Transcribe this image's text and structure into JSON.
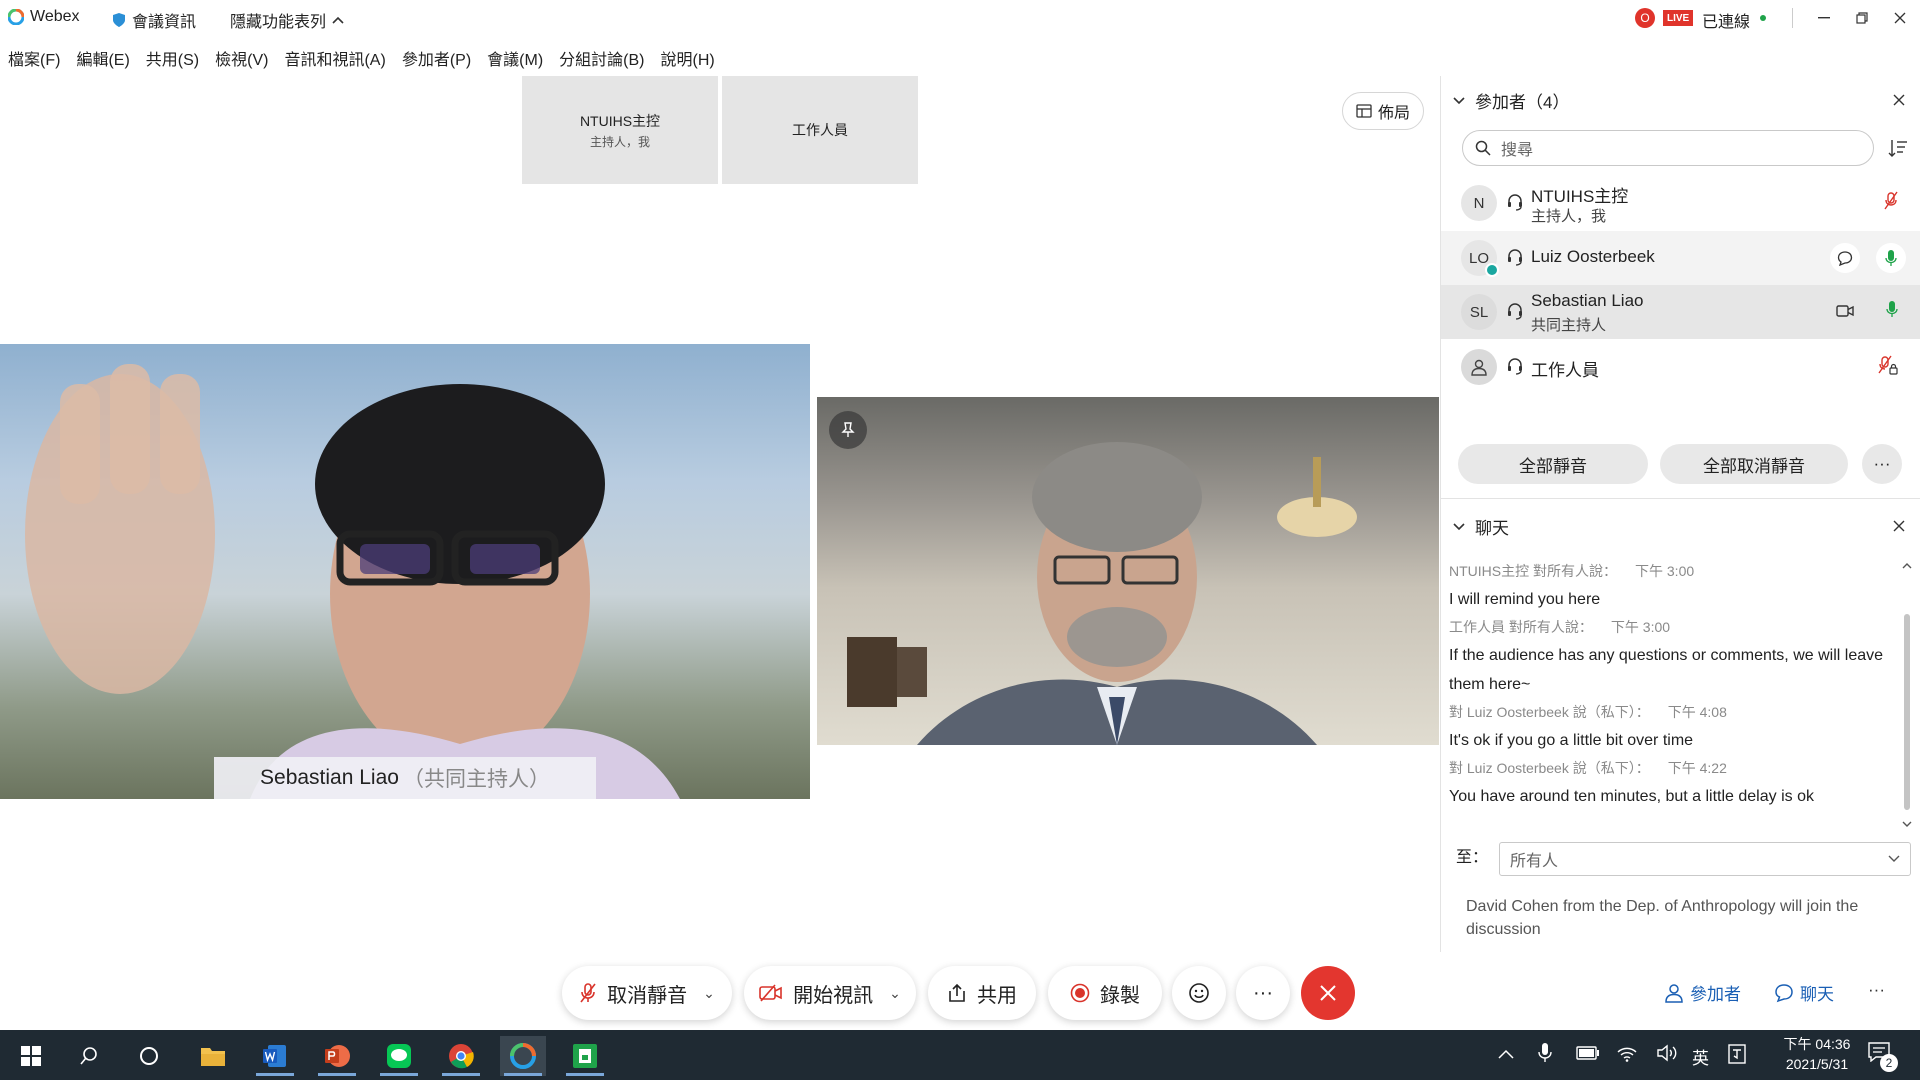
{
  "titlebar": {
    "app_name": "Webex",
    "meeting_info": "會議資訊",
    "hide_menu": "隱藏功能表列",
    "rec_count": "O",
    "live_badge": "LIVE",
    "connection": "已連線"
  },
  "menu": [
    "檔案(F)",
    "編輯(E)",
    "共用(S)",
    "檢視(V)",
    "音訊和視訊(A)",
    "參加者(P)",
    "會議(M)",
    "分組討論(B)",
    "說明(H)"
  ],
  "thumbnails": [
    {
      "name": "NTUIHS主控",
      "sub": "主持人，我"
    },
    {
      "name": "工作人員",
      "sub": ""
    }
  ],
  "layout_button": "佈局",
  "video_main": {
    "name": "Sebastian Liao",
    "role": "（共同主持人）"
  },
  "toolbar": {
    "unmute": "取消靜音",
    "start_video": "開始視訊",
    "share": "共用",
    "record": "錄製",
    "more": "···"
  },
  "participants": {
    "header": "參加者（4）",
    "search_placeholder": "搜尋",
    "list": [
      {
        "initials": "N",
        "name": "NTUIHS主控",
        "role": "主持人，我"
      },
      {
        "initials": "LO",
        "name": "Luiz Oosterbeek",
        "role": ""
      },
      {
        "initials": "SL",
        "name": "Sebastian Liao",
        "role": "共同主持人"
      },
      {
        "initials": "",
        "name": "工作人員",
        "role": ""
      }
    ],
    "mute_all": "全部靜音",
    "unmute_all": "全部取消靜音",
    "more": "···"
  },
  "chat": {
    "header": "聊天",
    "messages": [
      {
        "meta": "NTUIHS主控 對所有人說：",
        "time": "下午 3:00",
        "text": "I will remind you here"
      },
      {
        "meta": "工作人員 對所有人說：",
        "time": "下午 3:00",
        "text": "If the audience has any questions or comments, we will leave them here~"
      },
      {
        "meta": "對 Luiz Oosterbeek 說（私下）：",
        "time": "下午 4:08",
        "text": "It's ok if you go a little bit over time"
      },
      {
        "meta": "對 Luiz Oosterbeek 說（私下）：",
        "time": "下午 4:22",
        "text": "You have around ten minutes, but a little delay is ok"
      }
    ],
    "to_label": "至：",
    "to_value": "所有人",
    "draft": "David Cohen from the Dep. of Anthropology will join the discussion"
  },
  "bottom_right": {
    "participants": "參加者",
    "chat": "聊天",
    "more": "···"
  },
  "taskbar": {
    "ime": "英",
    "time": "下午 04:36",
    "date": "2021/5/31",
    "notif_count": "2"
  },
  "colors": {
    "accent_blue": "#1a5fb4",
    "end_red": "#e3362f",
    "live_red": "#e0342b",
    "mic_green": "#1fa34a"
  }
}
